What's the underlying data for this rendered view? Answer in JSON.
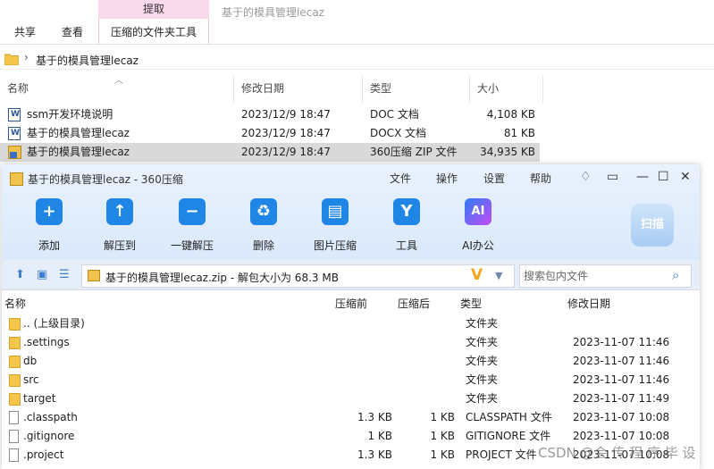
{
  "explorer": {
    "context_tab": "提取",
    "window_title": "基于的模具管理lecaz",
    "ribbon_tabs": [
      "共享",
      "查看"
    ],
    "context_group": "压缩的文件夹工具",
    "address": "基于的模具管理lecaz",
    "columns": {
      "name": "名称",
      "modified": "修改日期",
      "type": "类型",
      "size": "大小"
    },
    "rows": [
      {
        "name": "ssm开发环境说明",
        "modified": "2023/12/9 18:47",
        "type": "DOC 文档",
        "size": "4,108 KB"
      },
      {
        "name": "基于的模具管理lecaz",
        "modified": "2023/12/9 18:47",
        "type": "DOCX 文档",
        "size": "81 KB"
      },
      {
        "name": "基于的模具管理lecaz",
        "modified": "2023/12/9 18:47",
        "type": "360压缩 ZIP 文件",
        "size": "34,935 KB"
      }
    ]
  },
  "zip_window": {
    "title": "基于的模具管理lecaz - 360压缩",
    "menu": [
      "文件",
      "操作",
      "设置",
      "帮助"
    ],
    "tools": [
      "添加",
      "解压到",
      "一键解压",
      "删除",
      "图片压缩",
      "工具",
      "AI办公"
    ],
    "scan_label": "扫描",
    "address": "基于的模具管理lecaz.zip - 解包大小为 68.3 MB",
    "search_placeholder": "搜索包内文件",
    "columns": {
      "name": "名称",
      "before": "压缩前",
      "after": "压缩后",
      "type": "类型",
      "modified": "修改日期"
    },
    "rows": [
      {
        "name": ".. (上级目录)",
        "before": "",
        "after": "",
        "type": "文件夹",
        "modified": "",
        "kind": "folder"
      },
      {
        "name": ".settings",
        "before": "",
        "after": "",
        "type": "文件夹",
        "modified": "2023-11-07 11:46",
        "kind": "folder"
      },
      {
        "name": "db",
        "before": "",
        "after": "",
        "type": "文件夹",
        "modified": "2023-11-07 11:46",
        "kind": "folder"
      },
      {
        "name": "src",
        "before": "",
        "after": "",
        "type": "文件夹",
        "modified": "2023-11-07 11:46",
        "kind": "folder"
      },
      {
        "name": "target",
        "before": "",
        "after": "",
        "type": "文件夹",
        "modified": "2023-11-07 11:49",
        "kind": "folder"
      },
      {
        "name": ".classpath",
        "before": "1.3 KB",
        "after": "1 KB",
        "type": "CLASSPATH 文件",
        "modified": "2023-11-07 10:08",
        "kind": "file"
      },
      {
        "name": ".gitignore",
        "before": "1 KB",
        "after": "1 KB",
        "type": "GITIGNORE 文件",
        "modified": "2023-11-07 10:08",
        "kind": "file"
      },
      {
        "name": ".project",
        "before": "1.3 KB",
        "after": "1 KB",
        "type": "PROJECT 文件",
        "modified": "2023-11-07 10:08",
        "kind": "file"
      }
    ]
  },
  "watermark": "CSDN @会 传 程 序 毕 设",
  "colors": {
    "accent": "#1f86e6",
    "context_tab": "#f9d9ec",
    "selection": "#d9d9d9",
    "folder": "#f5c649"
  }
}
